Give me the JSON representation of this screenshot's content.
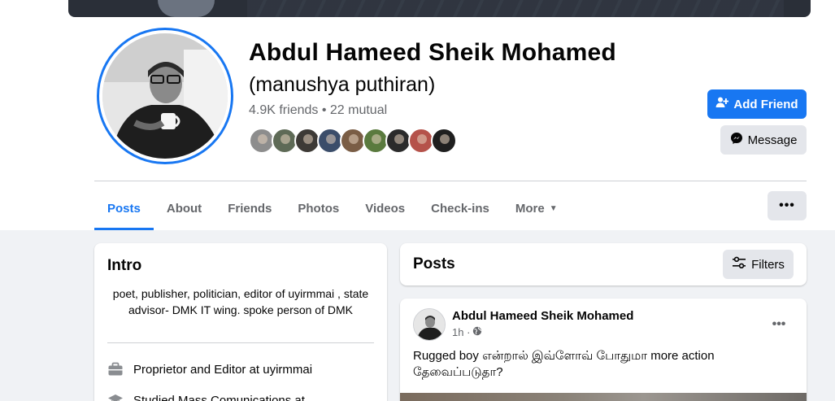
{
  "profile": {
    "name": "Abdul Hameed Sheik Mohamed",
    "alternate_name": "(manushya puthiran)",
    "friends_summary": "4.9K friends • 22 mutual",
    "mutual_friend_colors": [
      "#8d8d8d",
      "#5e6a56",
      "#3d3a36",
      "#3b4d6a",
      "#7a5d45",
      "#5a7a3e",
      "#2b2b2b",
      "#b5524a",
      "#1f1f1f"
    ]
  },
  "actions": {
    "add_friend_label": "Add Friend",
    "message_label": "Message",
    "more_options_label": "•••"
  },
  "tabs": [
    {
      "label": "Posts",
      "active": true
    },
    {
      "label": "About"
    },
    {
      "label": "Friends"
    },
    {
      "label": "Photos"
    },
    {
      "label": "Videos"
    },
    {
      "label": "Check-ins"
    },
    {
      "label": "More"
    }
  ],
  "intro": {
    "title": "Intro",
    "bio": "poet, publisher, politician, editor of uyirmmai , state advisor- DMK IT wing. spoke person of DMK",
    "items": [
      {
        "icon": "briefcase-icon",
        "text": "Proprietor and Editor at uyirmmai"
      },
      {
        "icon": "graduation-cap-icon",
        "text": "Studied Mass Comunications at"
      }
    ]
  },
  "posts": {
    "title": "Posts",
    "filters_label": "Filters",
    "items": [
      {
        "author": "Abdul Hameed Sheik Mohamed",
        "time": "1h ·",
        "privacy_icon": "globe-icon",
        "text": "Rugged boy என்றால் இவ்ளோவ் போதுமா more action தேவைப்படுதா?",
        "menu_label": "•••"
      }
    ]
  },
  "colors": {
    "accent": "#1877f2",
    "page_background": "#f0f2f5",
    "secondary_text": "#65676b",
    "button_gray": "#e4e6eb"
  }
}
